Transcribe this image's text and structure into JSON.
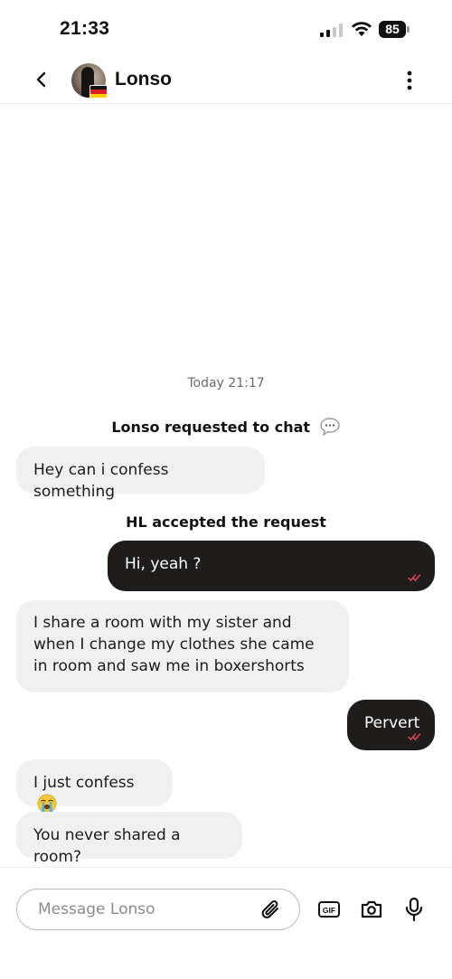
{
  "status_bar": {
    "time": "21:33",
    "battery": "85"
  },
  "header": {
    "contact_name": "Lonso",
    "back_icon": "chevron-left-icon",
    "more_icon": "vertical-dots-icon",
    "flag": "germany-flag"
  },
  "conversation": {
    "timestamp": "Today 21:17",
    "request_notice": "Lonso requested to chat",
    "accepted_notice": "HL accepted the request",
    "messages": [
      {
        "direction": "incoming",
        "text": "Hey can i confess something"
      },
      {
        "direction": "outgoing",
        "text": "Hi, yeah ?",
        "read": true
      },
      {
        "direction": "incoming",
        "text": "I share a room with my sister and when I change my clothes she came in room and saw me in boxershorts"
      },
      {
        "direction": "outgoing",
        "text": "Pervert",
        "read": true
      },
      {
        "direction": "incoming",
        "text": "I just confess",
        "emoji": "loudly-crying-face"
      },
      {
        "direction": "incoming",
        "text": "You never shared a room?"
      }
    ]
  },
  "composer": {
    "placeholder": "Message Lonso",
    "value": "",
    "gif_label": "GIF"
  },
  "colors": {
    "outgoing_bubble": "#1f1c1c",
    "incoming_bubble": "#f1f0f0",
    "read_ticks": "#e8475f"
  }
}
